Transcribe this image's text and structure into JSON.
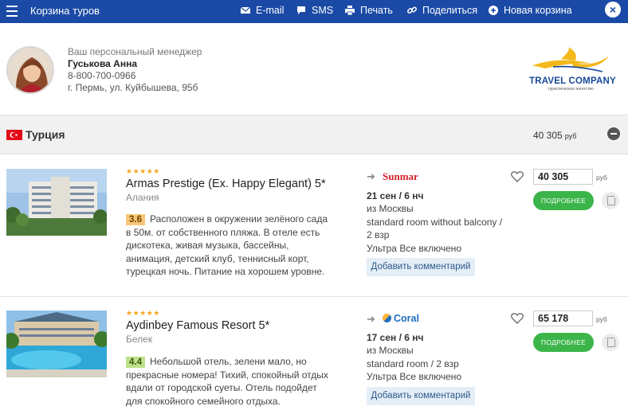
{
  "header": {
    "title": "Корзина туров",
    "email_label": "E-mail",
    "sms_label": "SMS",
    "print_label": "Печать",
    "share_label": "Поделиться",
    "new_cart_label": "Новая корзина",
    "bar_color": "#1b4aa6"
  },
  "manager": {
    "caption": "Ваш персональный менеджер",
    "name": "Гуськова Анна",
    "phone": "8-800-700-0966",
    "address": "г. Пермь, ул. Куйбышева, 95б"
  },
  "logo": {
    "name": "TRAVEL COMPANY",
    "subtitle": "туристическое агентство"
  },
  "country": {
    "name": "Турция",
    "total": "40 305",
    "currency": "руб"
  },
  "hotels": [
    {
      "stars": "★★★★★",
      "name": "Armas Prestige (Ex. Happy Elegant) 5*",
      "city": "Алания",
      "rating": "3.6",
      "description": "Расположен в окружении зелёного сада в 50м. от собственного пляжа. В отеле есть дискотека, живая музыка, бассейны, анимация, детский клуб, теннисный корт, турецкая ночь. Питание на хорошем уровне.",
      "operator": "Sunmar",
      "dates": "21 сен / 6 нч",
      "departure": "из Москвы",
      "room": "standard room without balcony / 2 взр",
      "meal": "Ультра Все включено",
      "comment_label": "Добавить комментарий",
      "price": "40 305",
      "currency": "руб",
      "more_label": "ПОДРОБНЕЕ"
    },
    {
      "stars": "★★★★★",
      "name": "Aydinbey Famous Resort 5*",
      "city": "Белек",
      "rating": "4.4",
      "description": "Небольшой отель, зелени мало, но прекрасные номера! Тихий, спокойный отдых вдали от городской суеты. Отель подойдет для спокойного семейного отдыха.",
      "operator": "Coral",
      "dates": "17 сен / 6 нч",
      "departure": "из Москвы",
      "room": "standard room / 2 взр",
      "meal": "Ультра Все включено",
      "comment_label": "Добавить комментарий",
      "price": "65 178",
      "currency": "руб",
      "more_label": "ПОДРОБНЕЕ"
    }
  ]
}
